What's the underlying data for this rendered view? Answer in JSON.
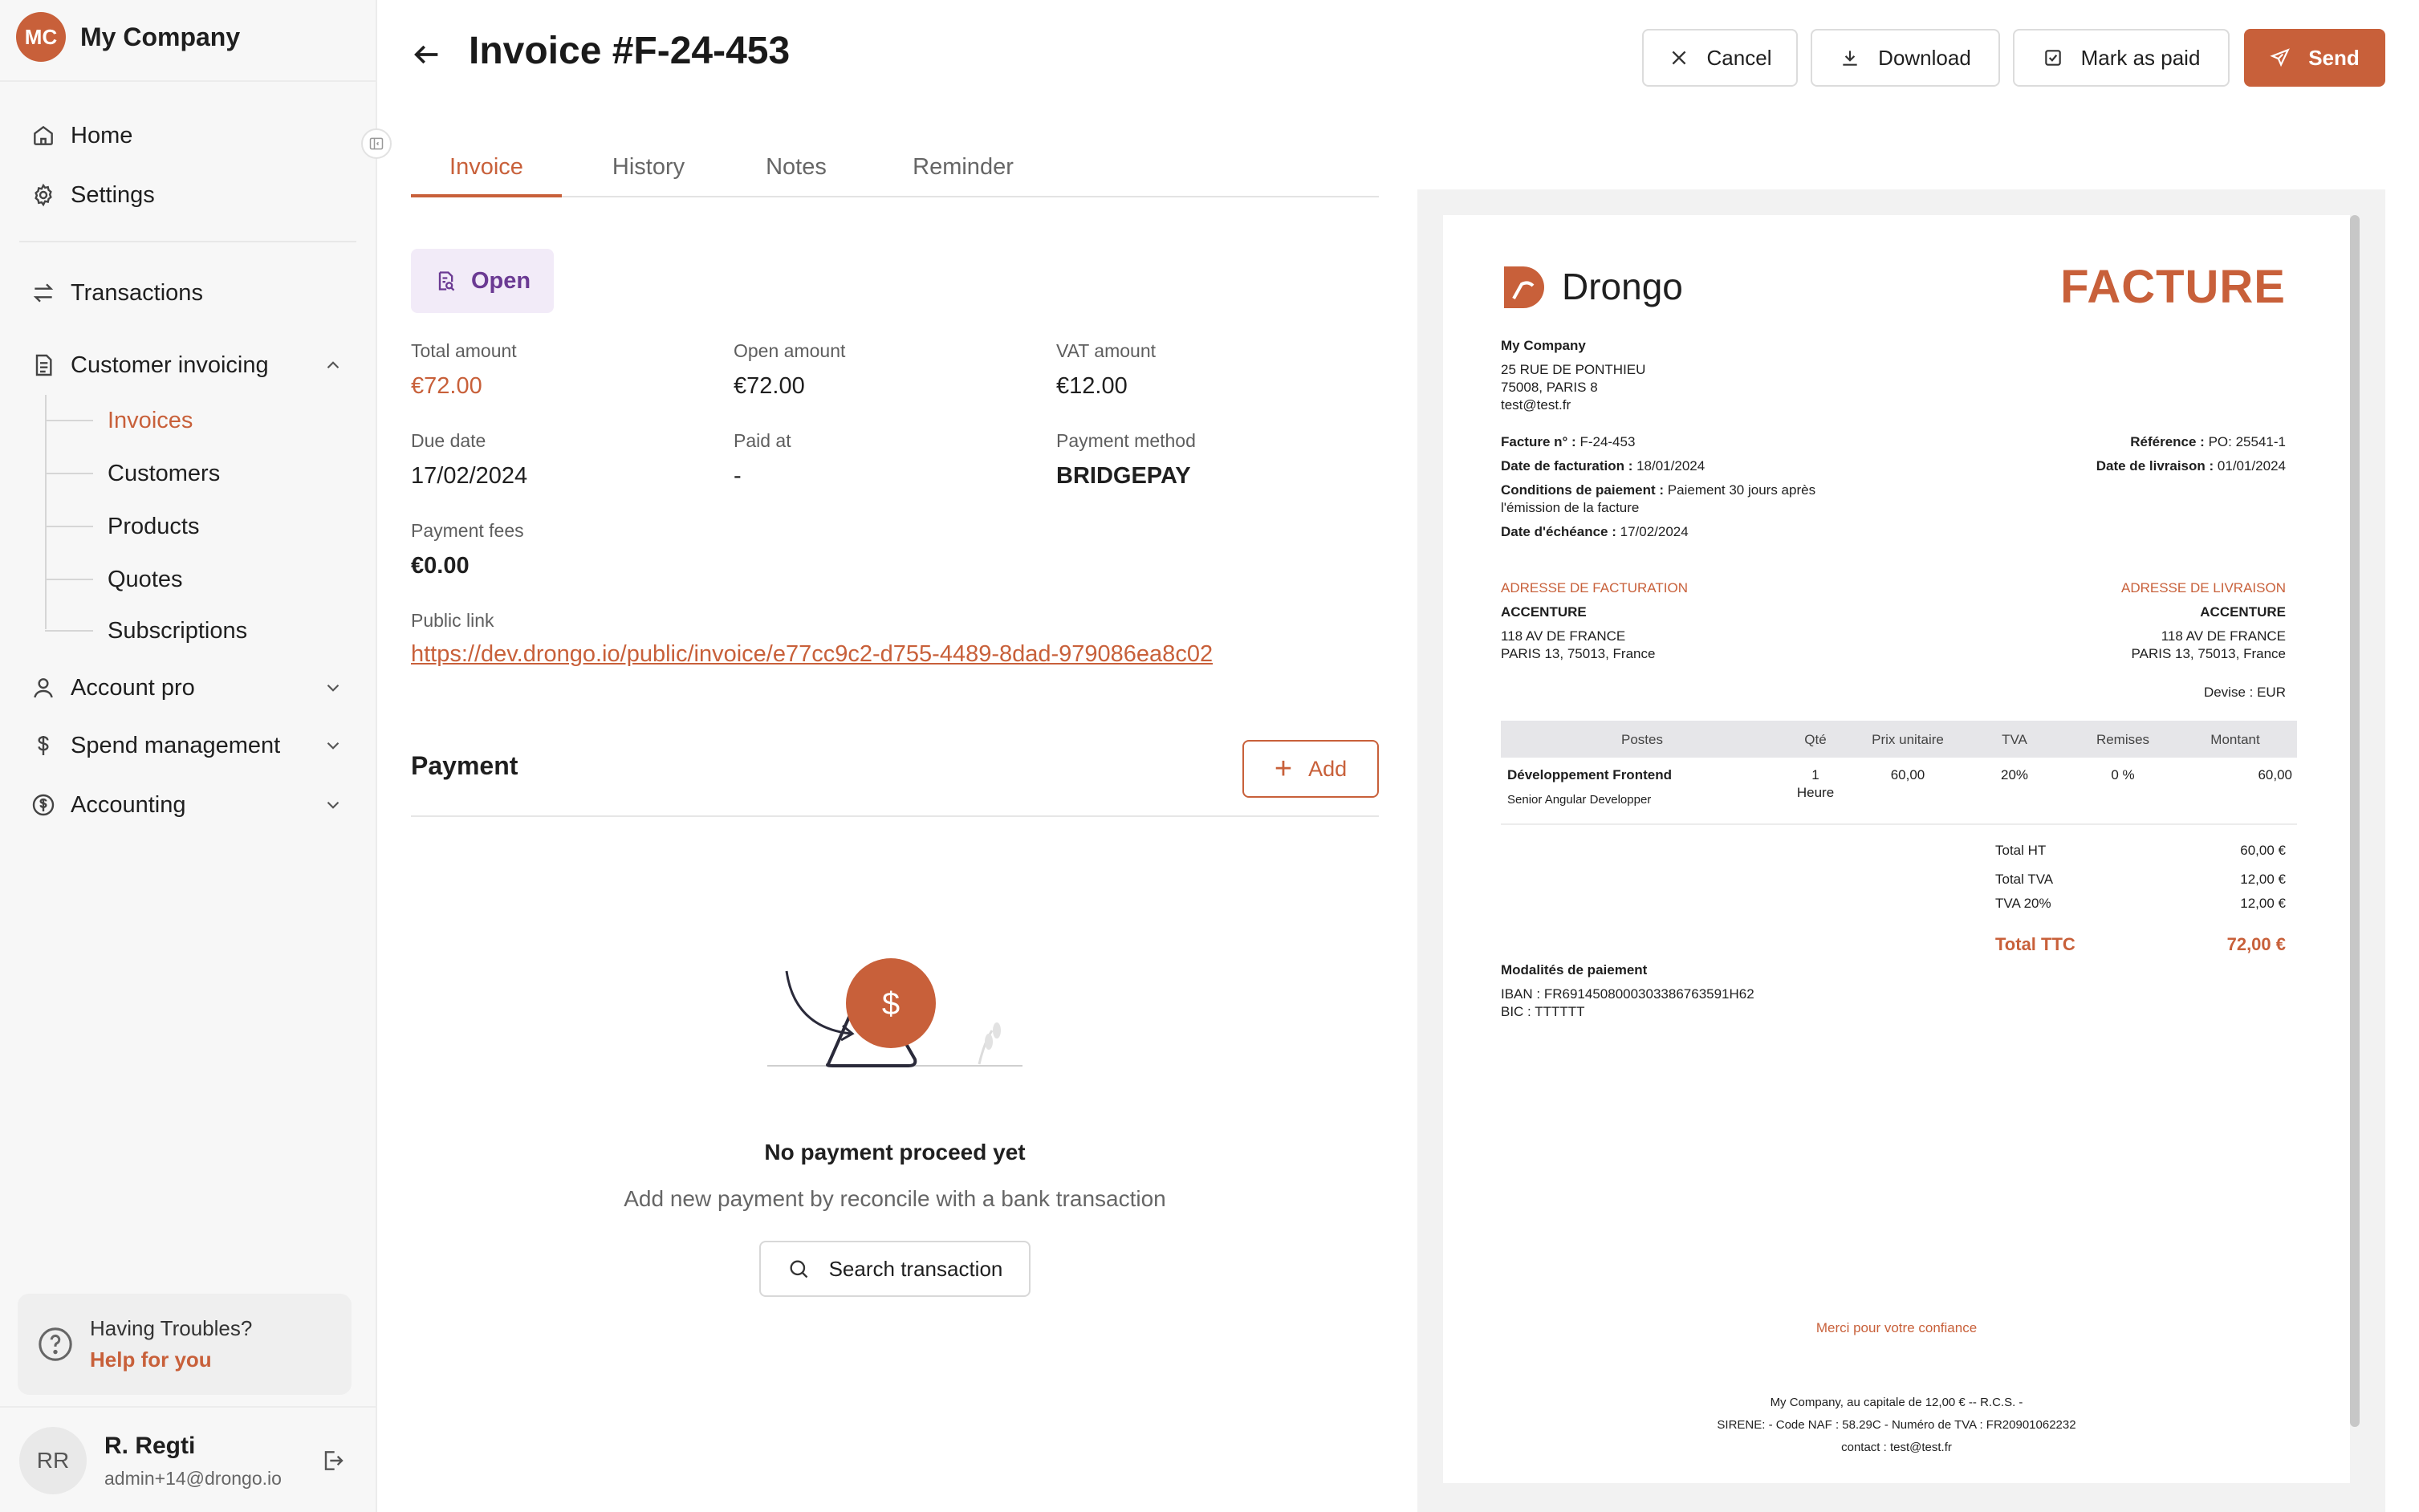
{
  "sidebar": {
    "company_initials": "MC",
    "company_name": "My Company",
    "nav": [
      {
        "label": "Home",
        "icon": "home-icon"
      },
      {
        "label": "Settings",
        "icon": "gear-icon"
      },
      {
        "label": "Transactions",
        "icon": "transfer-icon"
      },
      {
        "label": "Customer invoicing",
        "icon": "document-icon"
      },
      {
        "label": "Account pro",
        "icon": "user-icon"
      },
      {
        "label": "Spend management",
        "icon": "dollar-icon"
      },
      {
        "label": "Accounting",
        "icon": "coin-icon"
      }
    ],
    "sub_items": [
      "Invoices",
      "Customers",
      "Products",
      "Quotes",
      "Subscriptions"
    ],
    "help": {
      "title": "Having Troubles?",
      "link": "Help for you"
    },
    "user": {
      "initials": "RR",
      "name": "R. Regti",
      "email": "admin+14@drongo.io"
    }
  },
  "header": {
    "title": "Invoice #F-24-453",
    "buttons": {
      "cancel": "Cancel",
      "download": "Download",
      "mark_paid": "Mark as paid",
      "send": "Send"
    }
  },
  "tabs": [
    "Invoice",
    "History",
    "Notes",
    "Reminder"
  ],
  "status": "Open",
  "fields": {
    "total_amount": {
      "label": "Total amount",
      "value": "€72.00"
    },
    "open_amount": {
      "label": "Open amount",
      "value": "€72.00"
    },
    "vat_amount": {
      "label": "VAT amount",
      "value": "€12.00"
    },
    "due_date": {
      "label": "Due date",
      "value": "17/02/2024"
    },
    "paid_at": {
      "label": "Paid at",
      "value": "-"
    },
    "payment_method": {
      "label": "Payment method",
      "value": "BRIDGEPAY"
    },
    "payment_fees": {
      "label": "Payment fees",
      "value": "€0.00"
    },
    "public_link": {
      "label": "Public link",
      "value": "https://dev.drongo.io/public/invoice/e77cc9c2-d755-4489-8dad-979086ea8c02"
    }
  },
  "payment": {
    "title": "Payment",
    "add_label": "Add",
    "empty_title": "No payment proceed yet",
    "empty_subtitle": "Add new payment by reconcile with a bank transaction",
    "search_label": "Search transaction"
  },
  "colors": {
    "accent": "#c8603a",
    "status_bg": "#f2ebf8",
    "status_text": "#6b3a93"
  },
  "preview": {
    "brand": "Drongo",
    "doc_type": "FACTURE",
    "issuer": {
      "name": "My Company",
      "address1": "25 RUE DE PONTHIEU",
      "address2": "75008, PARIS 8",
      "email": "test@test.fr"
    },
    "invoice_no_label": "Facture n° :",
    "invoice_no": "F-24-453",
    "date_label": "Date de facturation :",
    "date": "18/01/2024",
    "terms_label": "Conditions de paiement :",
    "terms": "Paiement 30 jours après",
    "terms2": "l'émission de la facture",
    "due_label": "Date d'échéance :",
    "due": "17/02/2024",
    "ref_label": "Référence :",
    "ref": "PO: 25541-1",
    "delivery_label": "Date de livraison :",
    "delivery": "01/01/2024",
    "billing_title": "ADRESSE DE FACTURATION",
    "shipping_title": "ADRESSE DE LIVRAISON",
    "client": {
      "name": "ACCENTURE",
      "address1": "118 AV DE FRANCE",
      "address2": "PARIS 13, 75013, France"
    },
    "currency_label": "Devise :",
    "currency": "EUR",
    "table_headers": [
      "Postes",
      "Qté",
      "Prix unitaire",
      "TVA",
      "Remises",
      "Montant"
    ],
    "row": {
      "title": "Développement Frontend",
      "subtitle": "Senior Angular Developper",
      "qty": "1",
      "unit": "Heure",
      "price": "60,00",
      "vat": "20%",
      "discount": "0 %",
      "amount": "60,00"
    },
    "totals": [
      {
        "label": "Total HT",
        "value": "60,00 €"
      },
      {
        "label": "Total TVA",
        "value": "12,00 €"
      },
      {
        "label": "TVA 20%",
        "value": "12,00 €"
      }
    ],
    "ttc_label": "Total TTC",
    "ttc_value": "72,00 €",
    "payment_modes_title": "Modalités de paiement",
    "iban": "IBAN : FR6914508000303386763591H62",
    "bic": "BIC : TTTTTT",
    "thanks": "Merci pour votre confiance",
    "footer1": "My Company, au capitale de 12,00 € -- R.C.S. -",
    "footer2": "SIRENE: - Code NAF : 58.29C - Numéro de TVA : FR20901062232",
    "footer3": "contact : test@test.fr"
  }
}
